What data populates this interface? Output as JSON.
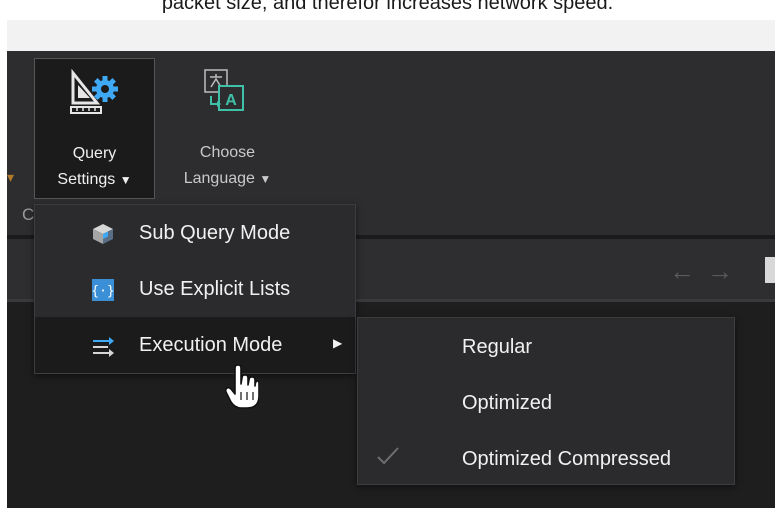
{
  "caption": "packet size, and therefor increases network speed.",
  "ribbon": {
    "query_settings": {
      "line1": "Query",
      "line2": "Settings",
      "caret": "▼"
    },
    "choose_language": {
      "line1": "Choose",
      "line2": "Language",
      "caret": "▼"
    },
    "edge_letter": "C"
  },
  "nav": {
    "arrows": "←→"
  },
  "menu": {
    "items": [
      {
        "label": "Sub Query Mode",
        "icon": "cube-icon"
      },
      {
        "label": "Use Explicit Lists",
        "icon": "braces-icon"
      },
      {
        "label": "Execution Mode",
        "icon": "execution-arrows-icon",
        "has_submenu": true
      }
    ]
  },
  "submenu": {
    "items": [
      {
        "label": "Regular",
        "checked": false
      },
      {
        "label": "Optimized",
        "checked": false
      },
      {
        "label": "Optimized Compressed",
        "checked": true
      }
    ]
  },
  "colors": {
    "ribbon_bg": "#2d2d30",
    "menu_bg": "#2b2b2d",
    "highlight_bg": "#1b1b1c",
    "icon_accent": "#3fa9f5",
    "text": "#f1f1f1"
  }
}
